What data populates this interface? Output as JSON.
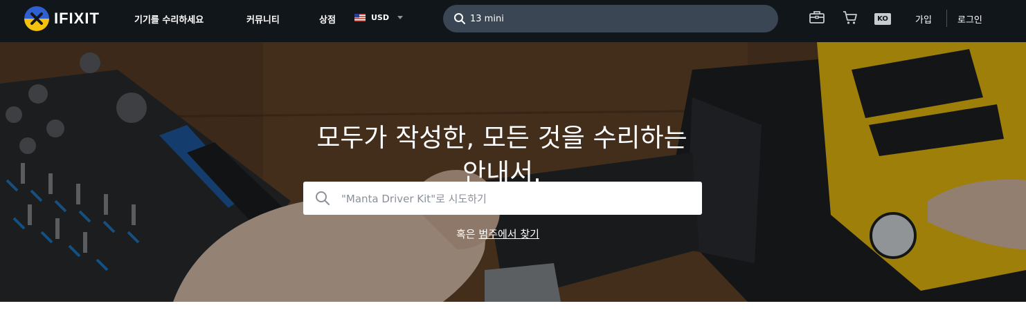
{
  "header": {
    "logo_text": "IFIXIT",
    "nav": [
      "기기를 수리하세요",
      "커뮤니티",
      "상점"
    ],
    "currency": "USD",
    "search_value": "13 mini",
    "language": "KO",
    "signup": "가입",
    "login": "로그인"
  },
  "hero": {
    "title_line1": "모두가 작성한, 모든 것을 수리하는",
    "title_line2": "안내서.",
    "search_placeholder": "\"Manta Driver Kit\"로 시도하기",
    "browse_prefix": "혹은",
    "browse_link": "범주에서 찾기"
  },
  "colors": {
    "topbar_bg": "#11161a",
    "search_bg": "#3b4654",
    "drill_yellow": "#f1c40f"
  }
}
